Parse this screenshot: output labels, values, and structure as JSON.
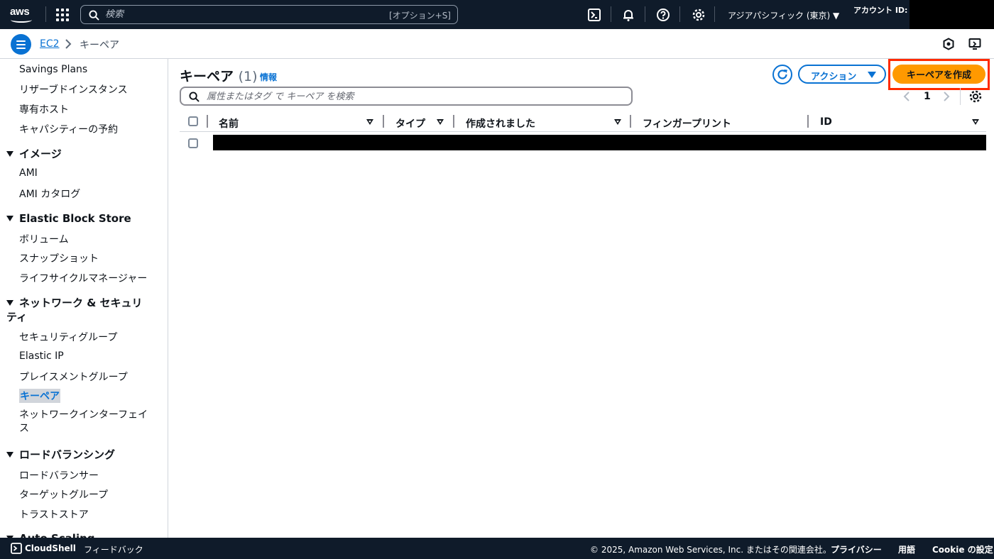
{
  "topnav": {
    "logo_text": "aws",
    "search_placeholder": "検索",
    "search_shortcut": "[オプション+S]",
    "region": "アジアパシフィック (東京) ▼",
    "account_label": "アカウント ID:"
  },
  "breadcrumb": {
    "root": "EC2",
    "current": "キーペア"
  },
  "sidebar": {
    "items": [
      {
        "type": "link",
        "label": "Savings Plans"
      },
      {
        "type": "link",
        "label": "リザーブドインスタンス"
      },
      {
        "type": "link",
        "label": "専有ホスト"
      },
      {
        "type": "link",
        "label": "キャパシティーの予約"
      },
      {
        "type": "section",
        "label": "イメージ"
      },
      {
        "type": "link",
        "label": "AMI"
      },
      {
        "type": "link",
        "label": "AMI カタログ"
      },
      {
        "type": "section",
        "label": "Elastic Block Store"
      },
      {
        "type": "link",
        "label": "ボリューム"
      },
      {
        "type": "link",
        "label": "スナップショット"
      },
      {
        "type": "link",
        "label": "ライフサイクルマネージャー"
      },
      {
        "type": "section",
        "label": "ネットワーク & セキュリティ"
      },
      {
        "type": "link",
        "label": "セキュリティグループ"
      },
      {
        "type": "link",
        "label": "Elastic IP"
      },
      {
        "type": "link",
        "label": "プレイスメントグループ"
      },
      {
        "type": "link",
        "label": "キーペア",
        "active": true
      },
      {
        "type": "link",
        "label": "ネットワークインターフェイス"
      },
      {
        "type": "section",
        "label": "ロードバランシング"
      },
      {
        "type": "link",
        "label": "ロードバランサー"
      },
      {
        "type": "link",
        "label": "ターゲットグループ"
      },
      {
        "type": "link",
        "label": "トラストストア"
      },
      {
        "type": "section",
        "label": "Auto Scaling"
      }
    ]
  },
  "main": {
    "title": "キーペア",
    "count": "(1)",
    "info": "情報",
    "actions_label": "アクション",
    "create_label": "キーペアを作成",
    "filter_placeholder": "属性またはタグ で キーペア を検索",
    "page_number": "1",
    "columns": [
      "名前",
      "タイプ",
      "作成されました",
      "フィンガープリント",
      "ID"
    ]
  },
  "footer": {
    "cloudshell": "CloudShell",
    "feedback": "フィードバック",
    "copyright": "© 2025, Amazon Web Services, Inc. またはその関連会社。",
    "privacy": "プライバシー",
    "terms": "用語",
    "cookie": "Cookie の設定"
  },
  "colors": {
    "nav_bg": "#0f1b2a",
    "link_blue": "#0972d3",
    "primary_orange": "#ff9900",
    "highlight_red": "#ff2a00"
  }
}
